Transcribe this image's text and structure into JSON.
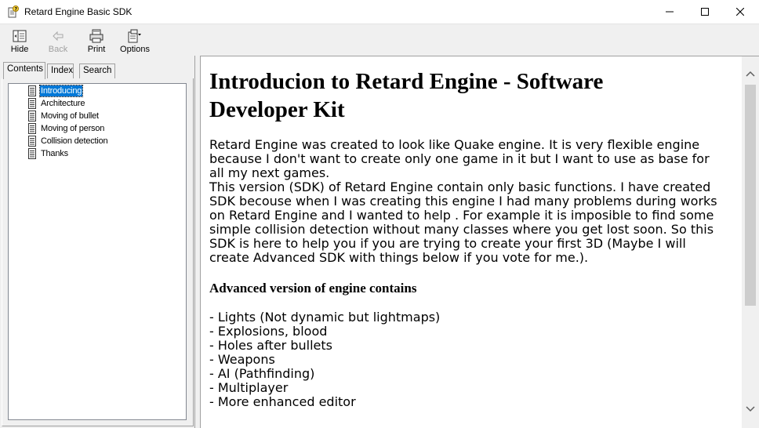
{
  "window": {
    "title": "Retard Engine Basic SDK"
  },
  "toolbar": {
    "hide_label": "Hide",
    "back_label": "Back",
    "print_label": "Print",
    "options_label": "Options"
  },
  "tabs": {
    "contents": "Contents",
    "index": "Index",
    "search": "Search"
  },
  "tree": {
    "items": [
      {
        "label": "Introducing",
        "selected": true
      },
      {
        "label": "Architecture"
      },
      {
        "label": "Moving of bullet"
      },
      {
        "label": "Moving of person"
      },
      {
        "label": "Collision detection"
      },
      {
        "label": "Thanks"
      }
    ]
  },
  "content": {
    "heading_line1": "Introducion to Retard Engine - Software",
    "heading_line2": "Developer Kit",
    "para1_lines": [
      "Retard Engine was created to look like Quake engine. It is very flexible engine",
      "because I don't want to create only one game in it but I want to use as base for",
      "all my next games."
    ],
    "para2_lines": [
      "This version (SDK) of Retard Engine contain only basic functions. I have created",
      "SDK becouse when I was creating this engine I had many problems during works",
      "on Retard Engine and I wanted to help . For example it is imposible to find some",
      "simple collision detection without many classes where you get lost soon. So this",
      "SDK is here to help you if you are trying to create your first 3D (Maybe I will",
      "create Advanced SDK with things below if you vote for me.)."
    ],
    "subheading": "Advanced version of engine contains",
    "features": [
      "- Lights (Not dynamic but lightmaps)",
      "- Explosions, blood",
      "- Holes after bullets",
      "- Weapons",
      "- AI (Pathfinding)",
      "- Multiplayer",
      "- More enhanced editor"
    ]
  },
  "colors": {
    "selection": "#0078d7",
    "chrome": "#f0f0f0"
  }
}
